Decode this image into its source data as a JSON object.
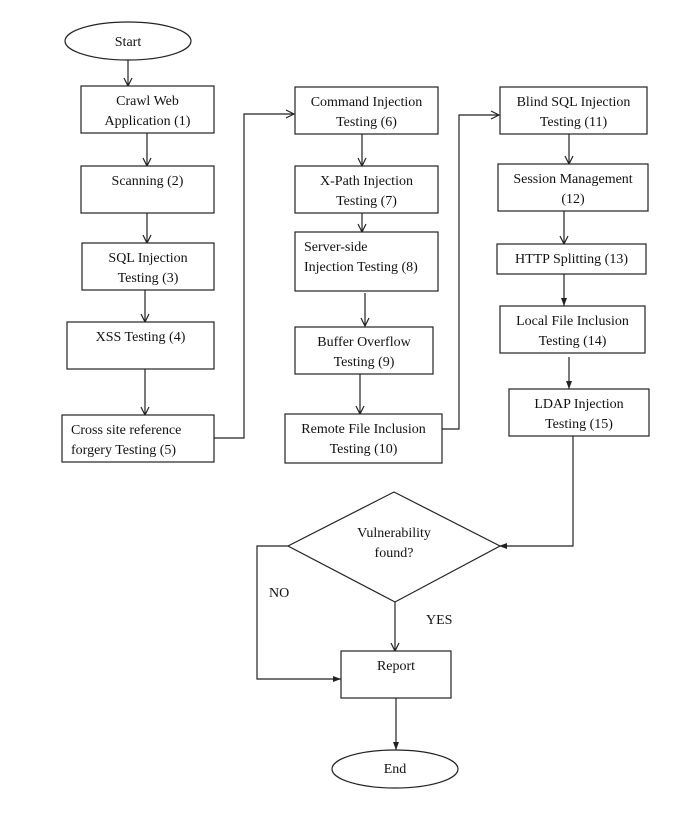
{
  "start": "Start",
  "end": "End",
  "steps": [
    [
      "Crawl Web",
      "Application (1)"
    ],
    [
      "Scanning (2)"
    ],
    [
      "SQL Injection",
      "Testing (3)"
    ],
    [
      "XSS Testing (4)"
    ],
    [
      "Cross site reference",
      "forgery Testing (5)"
    ],
    [
      "Command Injection",
      "Testing (6)"
    ],
    [
      "X-Path Injection",
      "Testing (7)"
    ],
    [
      "Server-side",
      "Injection Testing (8)"
    ],
    [
      "Buffer Overflow",
      "Testing (9)"
    ],
    [
      "Remote File Inclusion",
      "Testing (10)"
    ],
    [
      "Blind SQL Injection",
      "Testing (11)"
    ],
    [
      "Session Management",
      "(12)"
    ],
    [
      "HTTP Splitting (13)"
    ],
    [
      "Local File Inclusion",
      "Testing (14)"
    ],
    [
      "LDAP Injection",
      "Testing (15)"
    ]
  ],
  "decision": [
    "Vulnerability",
    "found?"
  ],
  "no_label": "NO",
  "yes_label": "YES",
  "report": "Report"
}
